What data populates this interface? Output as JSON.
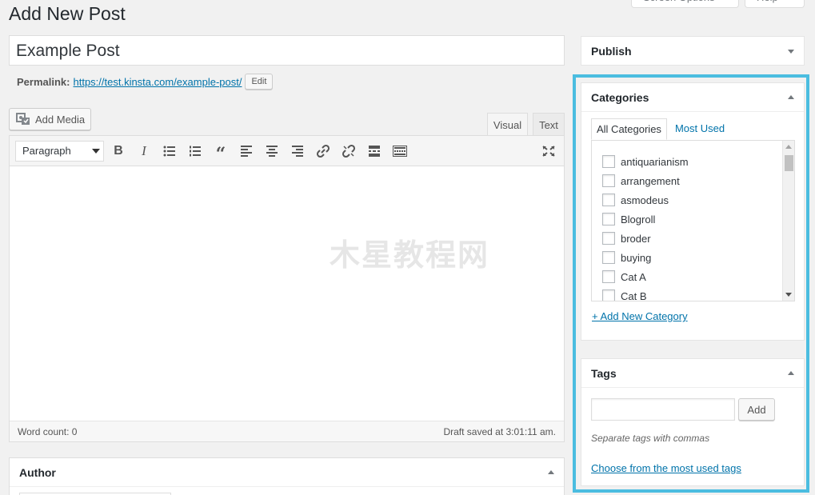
{
  "header": {
    "title": "Add New Post",
    "screen_options_label": "Screen Options",
    "help_label": "Help"
  },
  "post": {
    "title_value": "Example Post",
    "permalink_label": "Permalink:",
    "permalink_url": "https://test.kinsta.com/example-post/",
    "permalink_edit_label": "Edit"
  },
  "media": {
    "add_media_label": "Add Media"
  },
  "editor": {
    "tabs": [
      {
        "label": "Visual"
      },
      {
        "label": "Text"
      }
    ],
    "format_select": "Paragraph",
    "toolbar_icons": [
      "bold-icon",
      "italic-icon",
      "bulleted-list-icon",
      "numbered-list-icon",
      "blockquote-icon",
      "align-left-icon",
      "align-center-icon",
      "align-right-icon",
      "link-icon",
      "unlink-icon",
      "read-more-icon",
      "toolbar-toggle-icon",
      "fullscreen-icon"
    ],
    "word_count": "Word count: 0",
    "draft_saved": "Draft saved at 3:01:11 am.",
    "watermark": "木星教程网"
  },
  "author": {
    "title": "Author"
  },
  "publish": {
    "title": "Publish"
  },
  "categories": {
    "title": "Categories",
    "tabs": [
      {
        "label": "All Categories"
      },
      {
        "label": "Most Used"
      }
    ],
    "items": [
      {
        "label": "antiquarianism"
      },
      {
        "label": "arrangement"
      },
      {
        "label": "asmodeus"
      },
      {
        "label": "Blogroll"
      },
      {
        "label": "broder"
      },
      {
        "label": "buying"
      },
      {
        "label": "Cat A"
      },
      {
        "label": "Cat B"
      }
    ],
    "add_new_label": "+ Add New Category"
  },
  "tags": {
    "title": "Tags",
    "add_label": "Add",
    "hint": "Separate tags with commas",
    "choose_label": "Choose from the most used tags"
  },
  "colors": {
    "highlight": "#4bbde0",
    "link": "#0073aa"
  }
}
